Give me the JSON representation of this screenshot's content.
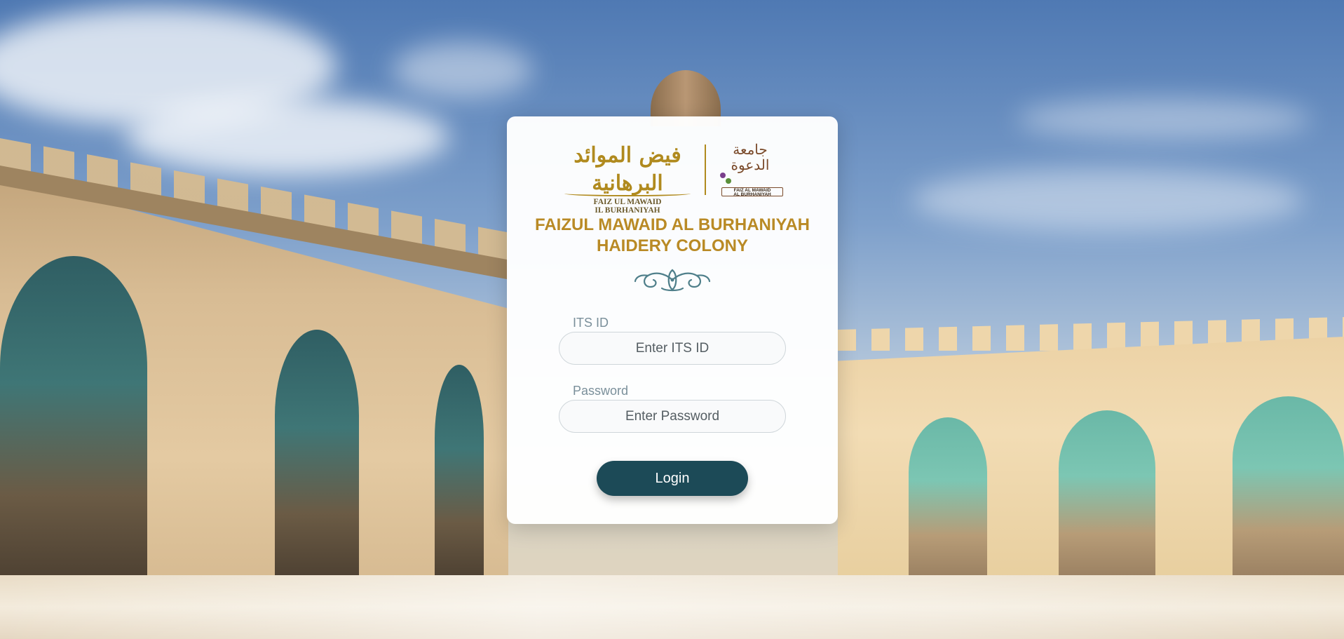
{
  "branding": {
    "logo_arabic": "فيض الموائد البرهانية",
    "logo_english_line1": "FAIZ UL MAWAID",
    "logo_english_line2": "IL BURHANIYAH",
    "seal_arabic": "جامعة الدعوة",
    "seal_tag_line1": "FAIZ AL MAWAID",
    "seal_tag_line2": "AL BURHANIYAH"
  },
  "title": {
    "line1": "FAIZUL MAWAID AL BURHANIYAH",
    "line2": "HAIDERY COLONY"
  },
  "form": {
    "its_label": "ITS ID",
    "its_placeholder": "Enter ITS ID",
    "password_label": "Password",
    "password_placeholder": "Enter Password",
    "login_label": "Login"
  },
  "colors": {
    "title": "#b98a25",
    "button": "#1c4a57",
    "label": "#7a8f9a",
    "ornament": "#4f7f8a"
  },
  "icons": {
    "ornament": "floral-ornament-icon"
  }
}
